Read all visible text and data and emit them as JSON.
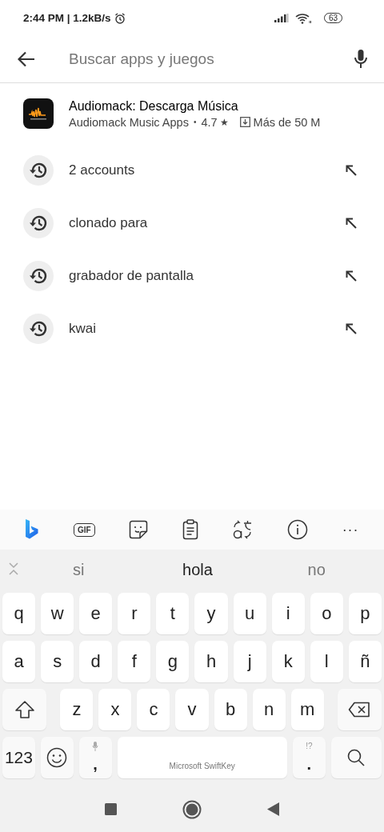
{
  "status_bar": {
    "text": "2:44 PM | 1.2kB/s",
    "battery": "63"
  },
  "search": {
    "placeholder": "Buscar apps y juegos"
  },
  "app_result": {
    "name": "Audiomack: Descarga Música",
    "developer": "Audiomack Music Apps",
    "separator": "•",
    "rating": "4.7",
    "star": "★",
    "downloads": "Más de 50 M"
  },
  "history": [
    "2 accounts",
    "clonado para",
    "grabador de pantalla",
    "kwai"
  ],
  "keyboard": {
    "gif_label": "GIF",
    "more": "···",
    "suggestions": [
      {
        "text": "si",
        "selected": false
      },
      {
        "text": "hola",
        "selected": true
      },
      {
        "text": "no",
        "selected": false
      }
    ],
    "letter_rows": [
      {
        "keys": [
          {
            "kind": "char",
            "label": "q"
          },
          {
            "kind": "char",
            "label": "w"
          },
          {
            "kind": "char",
            "label": "e"
          },
          {
            "kind": "char",
            "label": "r"
          },
          {
            "kind": "char",
            "label": "t"
          },
          {
            "kind": "char",
            "label": "y"
          },
          {
            "kind": "char",
            "label": "u"
          },
          {
            "kind": "char",
            "label": "i"
          },
          {
            "kind": "char",
            "label": "o"
          },
          {
            "kind": "char",
            "label": "p"
          }
        ]
      },
      {
        "keys": [
          {
            "kind": "char",
            "label": "a"
          },
          {
            "kind": "char",
            "label": "s"
          },
          {
            "kind": "char",
            "label": "d"
          },
          {
            "kind": "char",
            "label": "f"
          },
          {
            "kind": "char",
            "label": "g"
          },
          {
            "kind": "char",
            "label": "h"
          },
          {
            "kind": "char",
            "label": "j"
          },
          {
            "kind": "char",
            "label": "k"
          },
          {
            "kind": "char",
            "label": "l"
          },
          {
            "kind": "char",
            "label": "ñ"
          }
        ]
      },
      {
        "keys": [
          {
            "kind": "shift"
          },
          {
            "kind": "char",
            "label": "z"
          },
          {
            "kind": "char",
            "label": "x"
          },
          {
            "kind": "char",
            "label": "c"
          },
          {
            "kind": "char",
            "label": "v"
          },
          {
            "kind": "char",
            "label": "b"
          },
          {
            "kind": "char",
            "label": "n"
          },
          {
            "kind": "char",
            "label": "m"
          },
          {
            "kind": "backspace"
          }
        ]
      }
    ],
    "bottom_row": [
      {
        "kind": "num",
        "label": "123"
      },
      {
        "kind": "emoji"
      },
      {
        "kind": "comma",
        "label": ","
      },
      {
        "kind": "space",
        "label": "Microsoft SwiftKey"
      },
      {
        "kind": "period",
        "label": ".",
        "hint": "!?"
      },
      {
        "kind": "search"
      }
    ]
  }
}
